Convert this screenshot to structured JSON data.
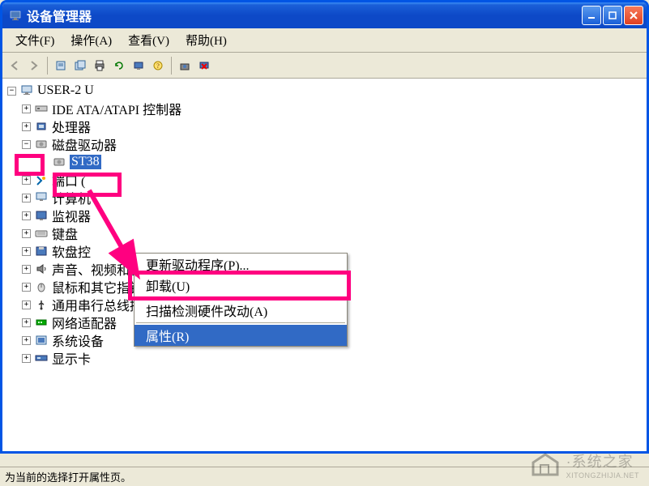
{
  "window": {
    "title": "设备管理器",
    "min": "_",
    "max": "□",
    "close": "×"
  },
  "menubar": {
    "file": "文件(F)",
    "action": "操作(A)",
    "view": "查看(V)",
    "help": "帮助(H)"
  },
  "tree": {
    "root": "USER-2            U",
    "ide": "IDE ATA/ATAPI 控制器",
    "cpu": "处理器",
    "disk": "磁盘驱动器",
    "disk_child": "ST38",
    "ports": "端口 (",
    "computer": "计算机",
    "monitor": "监视器",
    "keyboard": "键盘",
    "floppy": "软盘控",
    "sound": "声音、视频和游戏控制器",
    "mouse": "鼠标和其它指针设备",
    "usb": "通用串行总线控制器",
    "network": "网络适配器",
    "system": "系统设备",
    "display": "显示卡"
  },
  "context_menu": {
    "update": "更新驱动程序(P)...",
    "uninstall": "卸载(U)",
    "scan": "扫描检测硬件改动(A)",
    "properties": "属性(R)"
  },
  "statusbar": {
    "text": "为当前的选择打开属性页。"
  },
  "watermark": {
    "text": "·系统之家",
    "sub": "XITONGZHIJIA.NET"
  }
}
